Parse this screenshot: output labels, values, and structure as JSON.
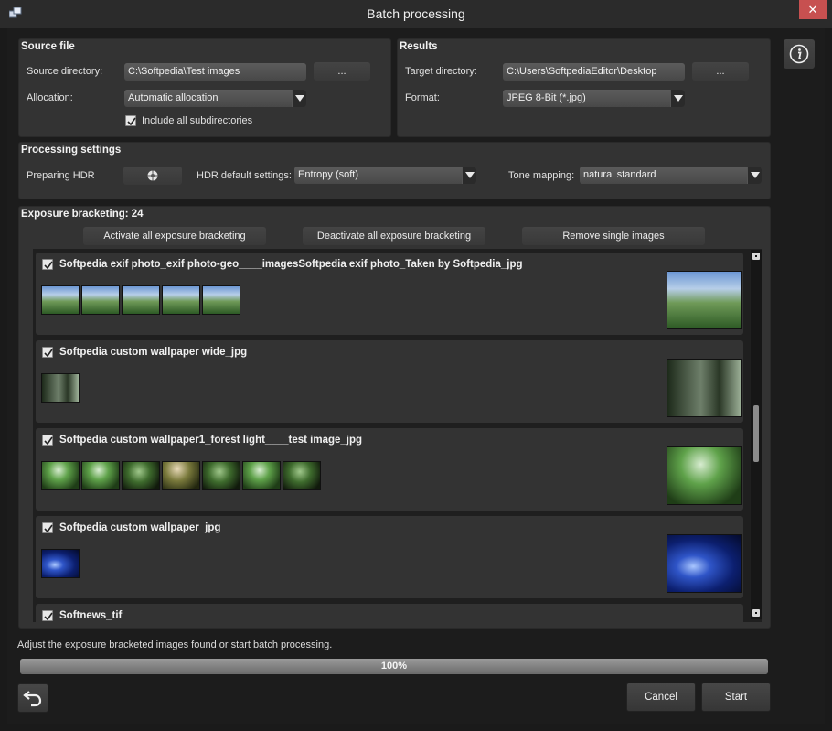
{
  "window": {
    "title": "Batch processing",
    "close_glyph": "✕"
  },
  "source": {
    "heading": "Source file",
    "dir_label": "Source directory:",
    "dir_value": "C:\\Softpedia\\Test images",
    "browse_label": "...",
    "alloc_label": "Allocation:",
    "alloc_value": "Automatic allocation",
    "subdirs_label": "Include all subdirectories",
    "subdirs_checked": true
  },
  "results": {
    "heading": "Results",
    "target_label": "Target directory:",
    "target_value": "C:\\Users\\SoftpediaEditor\\Desktop",
    "browse_label": "...",
    "format_label": "Format:",
    "format_value": "JPEG 8-Bit (*.jpg)"
  },
  "processing": {
    "heading": "Processing settings",
    "hdr_label": "Preparing HDR",
    "hdr_defaults_label": "HDR default settings:",
    "hdr_defaults_value": "Entropy (soft)",
    "tone_label": "Tone mapping:",
    "tone_value": "natural standard"
  },
  "bracketing": {
    "heading": "Exposure bracketing: 24",
    "activate_label": "Activate all exposure bracketing",
    "deactivate_label": "Deactivate all exposure bracketing",
    "remove_label": "Remove single images",
    "groups": [
      {
        "name": "Softpedia exif photo_exif photo-geo____imagesSoftpedia exif photo_Taken by Softpedia_jpg",
        "checked": true
      },
      {
        "name": "Softpedia custom wallpaper wide_jpg",
        "checked": true
      },
      {
        "name": "Softpedia custom wallpaper1_forest light____test image_jpg",
        "checked": true
      },
      {
        "name": "Softpedia custom wallpaper_jpg",
        "checked": true
      },
      {
        "name": "Softnews_tif",
        "checked": true
      }
    ]
  },
  "footer": {
    "status": "Adjust the exposure bracketed images found or start batch processing.",
    "progress_percent": 100,
    "progress_label": "100%",
    "cancel_label": "Cancel",
    "start_label": "Start"
  },
  "icons": {
    "app": "app-windows-icon",
    "info": "info-icon",
    "undo": "undo-arrow-icon",
    "hdr": "aperture-icon"
  }
}
